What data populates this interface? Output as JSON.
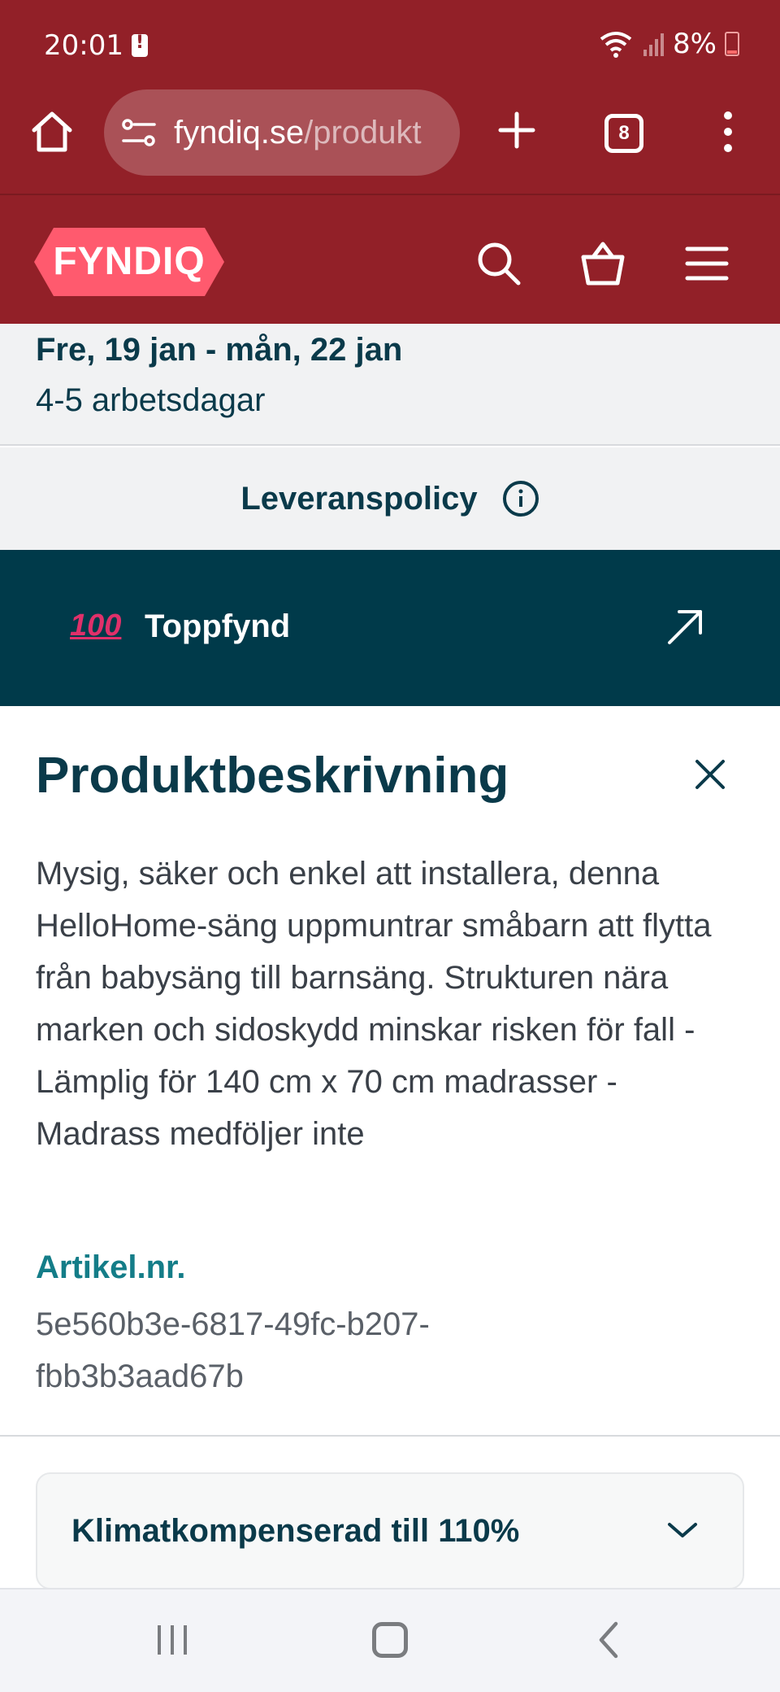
{
  "status_bar": {
    "time": "20:01",
    "battery": "8%",
    "icons": [
      "alert-icon",
      "wifi-icon",
      "signal-icon",
      "battery-icon"
    ]
  },
  "browser": {
    "url_host": "fyndiq.se",
    "url_path": "/produkt",
    "tab_count": "8",
    "icons": [
      "home-icon",
      "site-settings-icon",
      "new-tab-icon",
      "tabs-icon",
      "more-icon"
    ]
  },
  "site_header": {
    "logo": "FYNDIQ",
    "brand_color": "#922028",
    "logo_color": "#ff5a6e",
    "icons": [
      "search-icon",
      "cart-icon",
      "hamburger-menu-icon"
    ]
  },
  "delivery": {
    "date_range": "Fre, 19 jan - mån, 22 jan",
    "workdays": "4-5 arbetsdagar"
  },
  "policy": {
    "label": "Leveranspolicy"
  },
  "banner": {
    "emoji": "100",
    "label": "Toppfynd",
    "color": "#003a4a"
  },
  "description": {
    "title": "Produktbeskrivning",
    "body": "Mysig, säker och enkel att installera, denna HelloHome-säng uppmuntrar småbarn att flytta från babysäng till barnsäng. Strukturen nära marken och sidoskydd minskar risken för fall - Lämplig för 140 cm x 70 cm madrasser - Madrass medföljer inte",
    "article_label": "Artikel.nr.",
    "article_value": "5e560b3e-6817-49fc-b207-fbb3b3aad67b"
  },
  "accordion": {
    "label": "Klimatkompenserad till 110%"
  },
  "nav_bar": {
    "icons": [
      "recents-icon",
      "home-button-icon",
      "back-icon"
    ]
  }
}
